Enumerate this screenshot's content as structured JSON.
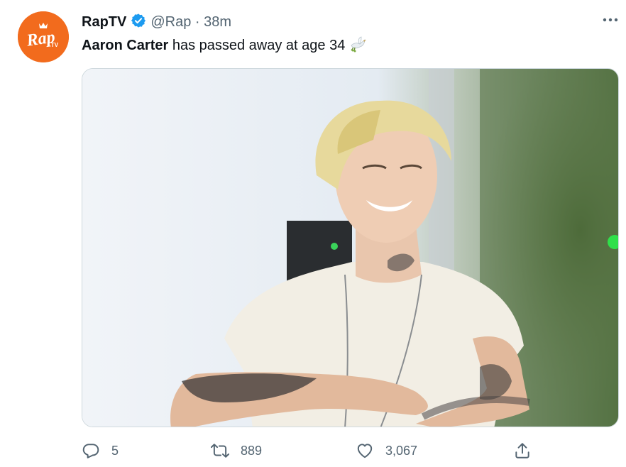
{
  "tweet": {
    "author_name": "RapTV",
    "handle": "@Rap",
    "separator": "·",
    "time": "38m",
    "text_bold": "Aaron Carter",
    "text_rest": " has passed away at age 34",
    "emoji": "dove-emoji",
    "avatar_logo_text": "Rap",
    "avatar_logo_sub": "TV"
  },
  "actions": {
    "replies": "5",
    "retweets": "889",
    "likes": "3,067"
  },
  "icons": {
    "verified": "verified-badge-icon",
    "more": "more-options-icon",
    "reply": "reply-icon",
    "retweet": "retweet-icon",
    "like": "heart-icon",
    "share": "share-icon"
  },
  "colors": {
    "brand_orange": "#f26b1d",
    "verified_blue": "#1d9bf0",
    "secondary_text": "#536471"
  }
}
